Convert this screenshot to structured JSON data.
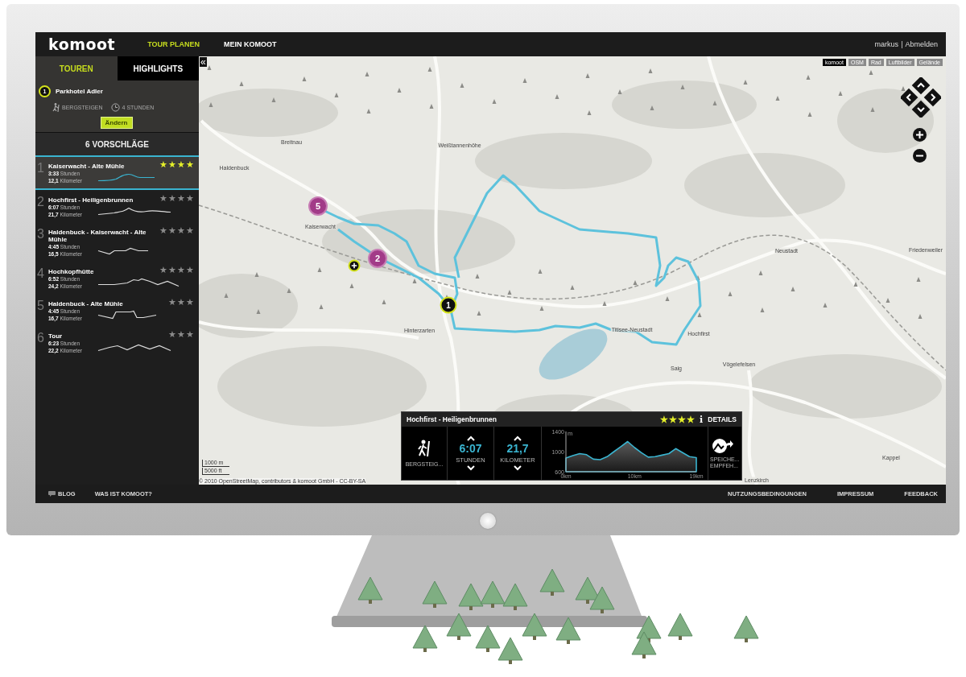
{
  "header": {
    "logo": "komoot",
    "nav": [
      {
        "label": "TOUR PLANEN",
        "selected": true
      },
      {
        "label": "MEIN KOMOOT",
        "selected": false
      }
    ],
    "user": "markus",
    "separator": "|",
    "logout": "Abmelden"
  },
  "sidebar": {
    "collapse": "«",
    "tabs": [
      {
        "label": "TOUREN",
        "selected": true
      },
      {
        "label": "HIGHLIGHTS",
        "selected": false
      }
    ],
    "start": {
      "marker": "1",
      "name": "Parkhotel Adler",
      "activity": "BERGSTEIGEN",
      "duration": "4 STUNDEN",
      "button": "Ändern"
    },
    "results_title": "6 VORSCHLÄGE",
    "tours": [
      {
        "number": "1",
        "title": "Kaiserwacht - Alte Mühle",
        "stars": 4,
        "selected": true,
        "time": "3:33",
        "time_unit": "Stunden",
        "distance": "12,1",
        "distance_unit": "Kilometer"
      },
      {
        "number": "2",
        "title": "Hochfirst - Heiligenbrunnen",
        "stars": 4,
        "selected": false,
        "time": "6:07",
        "time_unit": "Stunden",
        "distance": "21,7",
        "distance_unit": "Kilometer"
      },
      {
        "number": "3",
        "title": "Haldenbuck - Kaiserwacht - Alte Mühle",
        "stars": 4,
        "selected": false,
        "time": "4:45",
        "time_unit": "Stunden",
        "distance": "16,5",
        "distance_unit": "Kilometer"
      },
      {
        "number": "4",
        "title": "Hochkopfhütte",
        "stars": 4,
        "selected": false,
        "time": "6:52",
        "time_unit": "Stunden",
        "distance": "24,2",
        "distance_unit": "Kilometer"
      },
      {
        "number": "5",
        "title": "Haldenbuck - Alte Mühle",
        "stars": 3,
        "selected": false,
        "time": "4:45",
        "time_unit": "Stunden",
        "distance": "16,7",
        "distance_unit": "Kilometer"
      },
      {
        "number": "6",
        "title": "Tour",
        "stars": 3,
        "selected": false,
        "time": "6:23",
        "time_unit": "Stunden",
        "distance": "22,2",
        "distance_unit": "Kilometer"
      }
    ]
  },
  "map": {
    "layers": [
      {
        "label": "komoot",
        "selected": true
      },
      {
        "label": "OSM",
        "selected": false
      },
      {
        "label": "Rad",
        "selected": false
      },
      {
        "label": "Luftbilder",
        "selected": false
      },
      {
        "label": "Gelände",
        "selected": false
      }
    ],
    "places": [
      "Breitnau",
      "Weißtannenhöhe",
      "Haldenbuck",
      "Kaiserwacht",
      "Neustadt",
      "Friedenweiler",
      "Hinterzarten",
      "Titisee-Neustadt",
      "Hochfirst",
      "Saig",
      "Vögelefelsen",
      "Kappel",
      "Lenzkirch"
    ],
    "markers": [
      {
        "kind": "highlight",
        "label": "5"
      },
      {
        "kind": "highlight",
        "label": "2"
      },
      {
        "kind": "start",
        "label": "1"
      },
      {
        "kind": "add"
      }
    ],
    "scale": [
      "1000 m",
      "5000 ft"
    ],
    "attribution": "© 2010 OpenStreetMap, contributors & komoot GmbH - CC-BY-SA"
  },
  "info": {
    "title": "Hochfirst - Heiligenbrunnen",
    "stars": 4,
    "info_icon": "i",
    "details": "DETAILS",
    "activity": "BERGSTEIG...",
    "time": "6:07",
    "time_unit": "STUNDEN",
    "distance": "21,7",
    "distance_unit": "KILOMETER",
    "save": "SPEICHE...",
    "recommend": "EMPFEH...",
    "chart_data": {
      "type": "area",
      "ylabel": "m",
      "x": [
        0,
        1,
        2,
        3,
        4,
        5,
        6,
        7,
        8,
        9,
        10,
        11,
        12,
        13,
        14,
        15,
        16,
        17,
        18,
        19
      ],
      "series": [
        {
          "color": "#3ab4d0",
          "values": [
            870,
            920,
            960,
            940,
            850,
            840,
            900,
            1000,
            1100,
            1200,
            1080,
            980,
            890,
            900,
            930,
            960,
            1060,
            980,
            900,
            880
          ]
        }
      ],
      "xlim": [
        0,
        19
      ],
      "ylim": [
        600,
        1400
      ],
      "xticks": [
        {
          "value": 0,
          "label": "0km"
        },
        {
          "value": 10,
          "label": "10km"
        },
        {
          "value": 19,
          "label": "19km"
        }
      ],
      "yticks": [
        600,
        1000,
        1400
      ]
    }
  },
  "footer": {
    "left": [
      {
        "kind": "blog",
        "label": "BLOG"
      },
      {
        "kind": "link",
        "label": "WAS IST KOMOOT?"
      }
    ],
    "right": [
      "NUTZUNGSBEDINGUNGEN",
      "IMPRESSUM",
      "FEEDBACK"
    ]
  }
}
